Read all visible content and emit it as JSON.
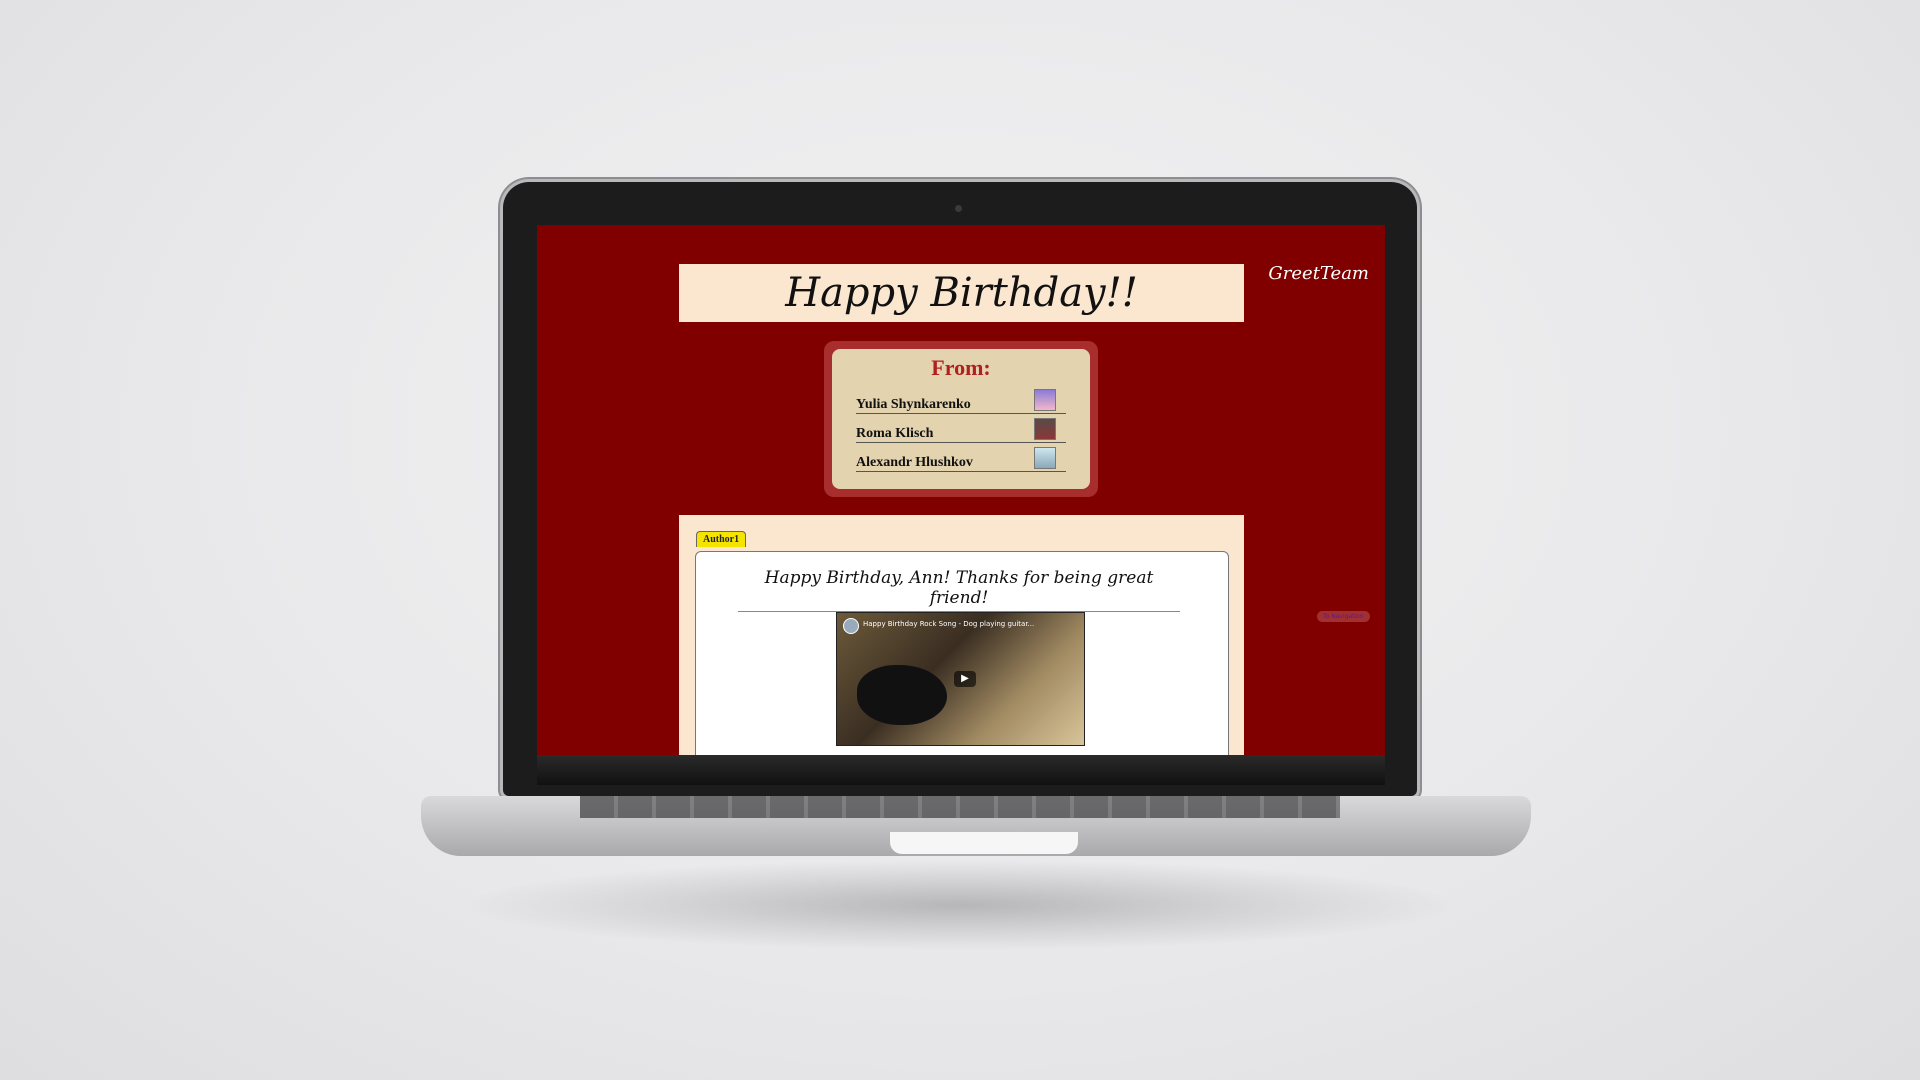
{
  "site": {
    "brand": "GreetTeam",
    "title": "Happy Birthday!!",
    "nav_pill": "To Navigation"
  },
  "from_card": {
    "title": "From:",
    "senders": [
      {
        "name": "Yulia Shynkarenko",
        "avatar": "avatar-cake"
      },
      {
        "name": "Roma Klisch",
        "avatar": "avatar-photo"
      },
      {
        "name": "Alexandr Hlushkov",
        "avatar": "avatar-photo"
      }
    ]
  },
  "message": {
    "tab_label": "Author1",
    "text": "Happy Birthday, Ann! Thanks for being great friend!",
    "video_title": "Happy Birthday Rock Song - Dog playing guitar...",
    "play_icon": "play-icon"
  },
  "colors": {
    "page_background": "#800000",
    "title_background": "#fbe6cf",
    "from_card_border": "#a82e2e",
    "from_title": "#b02020",
    "tab": "#f5e400"
  }
}
